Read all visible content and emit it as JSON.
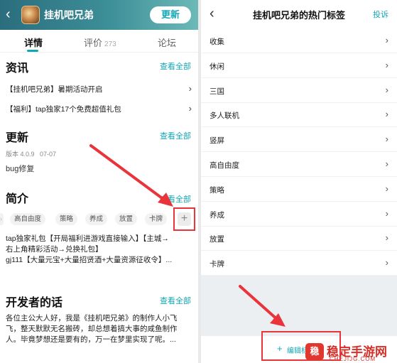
{
  "left": {
    "header": {
      "title": "挂机吧兄弟",
      "update_label": "更新"
    },
    "tabs": [
      {
        "label": "详情"
      },
      {
        "label": "评价",
        "count": "273"
      },
      {
        "label": "论坛"
      }
    ],
    "news": {
      "title": "资讯",
      "see_all": "查看全部",
      "items": [
        "【挂机吧兄弟】暑期活动开启",
        "【福利】tap独家17个免费超值礼包"
      ]
    },
    "update": {
      "title": "更新",
      "see_all": "查看全部",
      "version": "版本 4.0.9",
      "date": "07-07",
      "note": "bug修复"
    },
    "intro": {
      "title": "简介",
      "see_all": "查看全部",
      "tags": [
        "高自由度",
        "策略",
        "养成",
        "放置",
        "卡牌"
      ],
      "plus": "+",
      "lines": [
        "tap独家礼包【开局福利进游戏直接输入】【主城→",
        "右上角精彩活动→兑换礼包】",
        "gj111【大量元宝+大量招贤酒+大量资源征收令】..."
      ]
    },
    "developer": {
      "title": "开发者的话",
      "see_all": "查看全部",
      "lines": [
        "各位主公大人好，我是《挂机吧兄弟》的制作人小飞",
        "飞，整天默默无名搬砖，却总想着搞大事的咸鱼制作",
        "人。毕竟梦想还是要有的，万一在梦里实现了呢。..."
      ]
    }
  },
  "right": {
    "header": {
      "title": "挂机吧兄弟的热门标签",
      "report": "投诉"
    },
    "tags": [
      "收集",
      "休闲",
      "三国",
      "多人联机",
      "竖屏",
      "高自由度",
      "策略",
      "养成",
      "放置",
      "卡牌"
    ],
    "edit_label": "编辑标签",
    "edit_plus": "+"
  },
  "watermark": {
    "logo": "稳",
    "name": "稳定手游网",
    "url": "CHEJIJG.COM"
  },
  "colors": {
    "accent": "#13a7b5",
    "annotation": "#e8343a"
  }
}
